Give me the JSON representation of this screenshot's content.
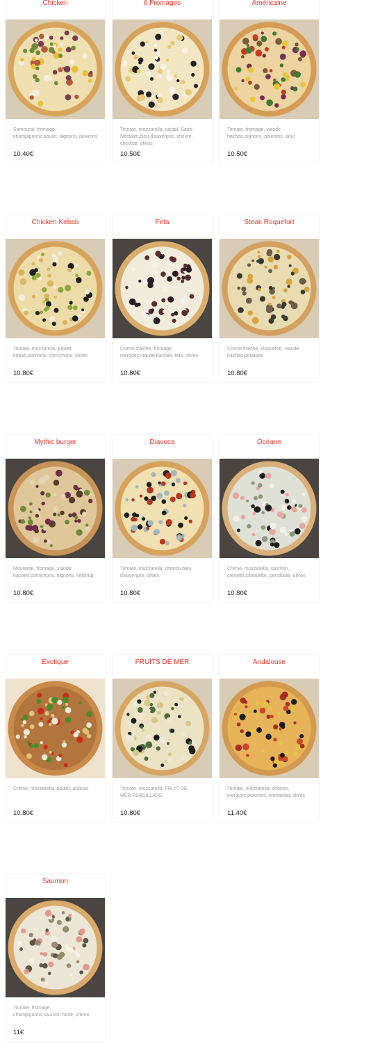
{
  "menu": {
    "pizzas": [
      {
        "name": "Chicken",
        "description": "Samouraï, fromage, champignons,poulet, oignons, poivrons",
        "price": "10.40€",
        "background": "box",
        "crust": "#d9a55c",
        "base": "#f0dfb0",
        "toppings": [
          "#b25a3a",
          "#e7c23a",
          "#f3f0e2",
          "#7a3b4f",
          "#6a8c3a"
        ]
      },
      {
        "name": "6 Fromages",
        "description": "Tomate, mozzarella, cantal, Saint-Nectaire,bleu d'auvergne, chèvre, cheddar, olives",
        "price": "10.50€",
        "background": "box",
        "crust": "#d7a25a",
        "base": "#f3e7c3",
        "toppings": [
          "#222222",
          "#f7f3e6",
          "#e6c97a"
        ]
      },
      {
        "name": "Américaine",
        "description": "Tomate, fromage, viande hachée,oignons, poivrons, oeuf",
        "price": "10.50€",
        "background": "box",
        "crust": "#d59c55",
        "base": "#eed4a0",
        "toppings": [
          "#7a2f56",
          "#c8391f",
          "#e8c53a",
          "#7c5b3a",
          "#3f7a32"
        ]
      },
      {
        "name": "Chicken Kebab",
        "description": "Tomate, mozzarella, poulet, kebab,poivrons, cornichons, olives",
        "price": "10.80€",
        "background": "box",
        "crust": "#d8a45d",
        "base": "#eedca8",
        "toppings": [
          "#1f1f1f",
          "#8da73a",
          "#f3eedc",
          "#d8b760"
        ]
      },
      {
        "name": "Feta",
        "description": "Crème fraîche, fromage, merguez,viande hachée, feta, olives",
        "price": "10.80€",
        "background": "dark",
        "crust": "#dbad6d",
        "base": "#f2ecdc",
        "toppings": [
          "#5b2b2b",
          "#2a1d24",
          "#f5f2ea"
        ]
      },
      {
        "name": "Steak Roquefort",
        "description": "Crème fraîche, Roquefort, viande hachée,potatoes",
        "price": "10.80€",
        "background": "box",
        "crust": "#d4a160",
        "base": "#eadcb2",
        "toppings": [
          "#d6a441",
          "#6d5e49",
          "#3a3a2e"
        ]
      },
      {
        "name": "Mythic burger",
        "description": "Moutarde, fromage, viande hachée,cornichons, oignons, ketchup",
        "price": "10.80€",
        "background": "dark",
        "crust": "#c99458",
        "base": "#e0c79a",
        "toppings": [
          "#6e2f4a",
          "#6d8a36",
          "#5b3a2a",
          "#e3d7b5"
        ]
      },
      {
        "name": "Diavoca",
        "description": "Tomate, mozzarella, chorizo,bleu d'auvergne, olives",
        "price": "10.80€",
        "background": "box",
        "crust": "#d6a25d",
        "base": "#f1e0b2",
        "toppings": [
          "#b6361f",
          "#1d1d1d",
          "#a7b6bd"
        ]
      },
      {
        "name": "Océane",
        "description": "Crème, mozzarella, saumon, crevette,ciboulette, persillade, olives",
        "price": "10.80€",
        "background": "dark",
        "crust": "#d9b07a",
        "base": "#dfe0d6",
        "toppings": [
          "#1e1e1e",
          "#e8a6a0",
          "#8a9a7a",
          "#f2efe5"
        ]
      },
      {
        "name": "Exotique",
        "description": "Crème, mozzarella, poulet, ananas",
        "price": "10.80€",
        "background": "wood",
        "crust": "#c98a4a",
        "base": "#b2753e",
        "toppings": [
          "#cc2b1d",
          "#4f8a2a",
          "#f0e9d6",
          "#e2c07a"
        ]
      },
      {
        "name": "FRUITS DE MER",
        "description": "Tomate, mozzarella, FRUIT DE MER,PERSILLADE",
        "price": "10.80€",
        "background": "box",
        "crust": "#d6a663",
        "base": "#ece3c5",
        "toppings": [
          "#1c1c1c",
          "#d6c98a",
          "#4f6b3a",
          "#efe8d4"
        ]
      },
      {
        "name": "Andalouse",
        "description": "Tomate, mozzarella, chorizo, merguez,poivrons, emmental, olives",
        "price": "11.40€",
        "background": "box",
        "crust": "#d39a50",
        "base": "#e7b45a",
        "toppings": [
          "#a5301d",
          "#1b1b1b",
          "#c84a2a",
          "#e5c640"
        ]
      },
      {
        "name": "Saumon",
        "description": "Tomate, fromage, champignons,saumon fumé, crème",
        "price": "11€",
        "background": "dark",
        "crust": "#d9aa6c",
        "base": "#ece6d6",
        "toppings": [
          "#e39a8e",
          "#5d5548",
          "#f5f1e6",
          "#9a8b70"
        ]
      }
    ]
  },
  "colors": {
    "title": "#e8352a",
    "description": "#9a9a9a",
    "price": "#222222",
    "box": "#d9ccb6",
    "dark": "#4a4540",
    "wood": "#efe3cd"
  }
}
